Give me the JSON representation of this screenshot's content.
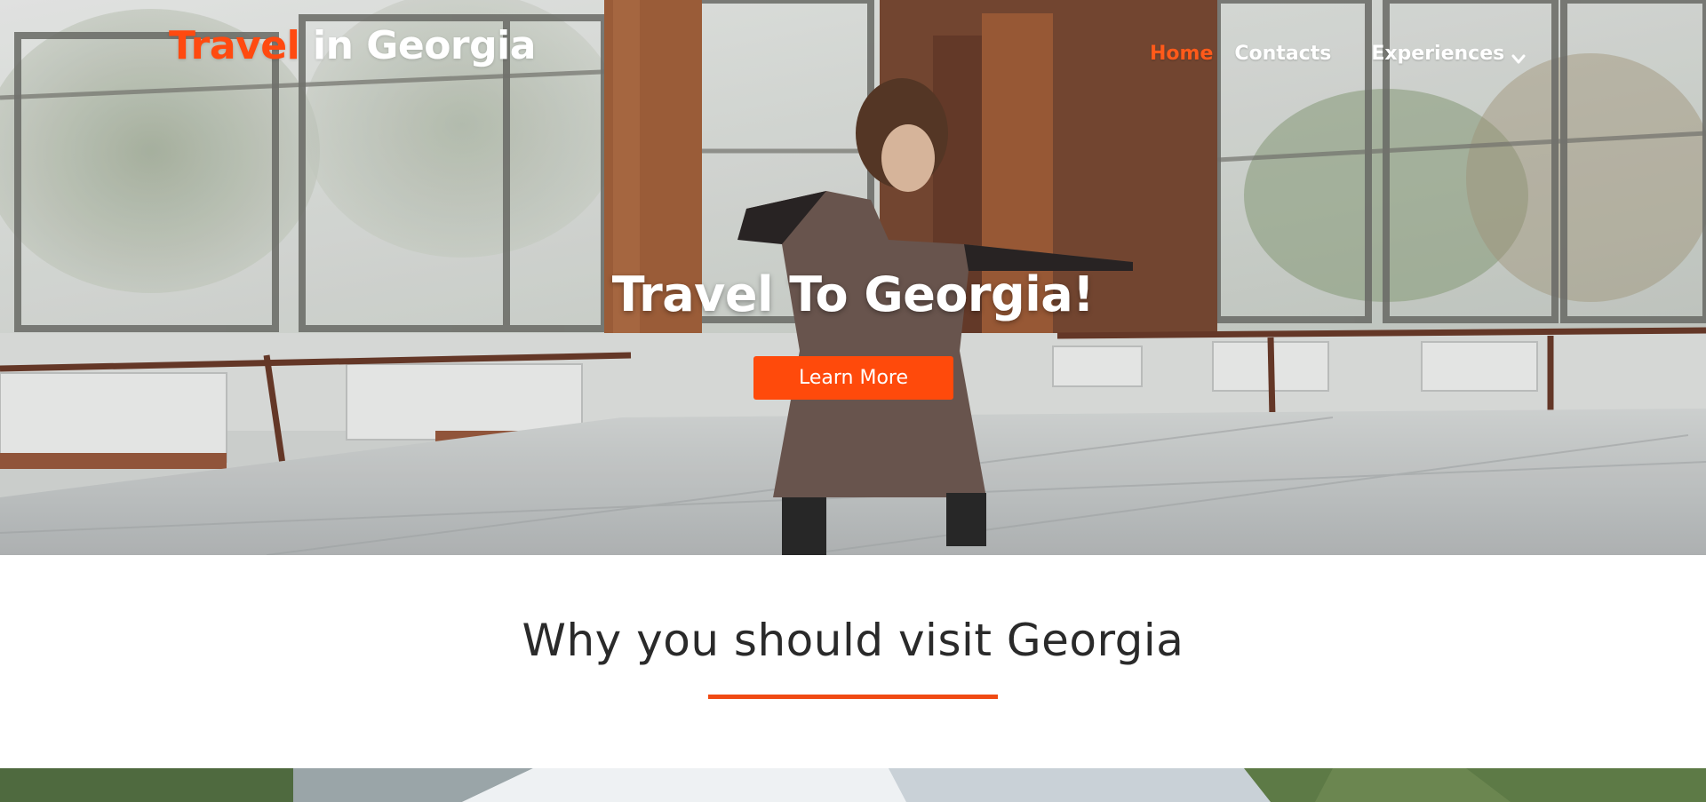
{
  "brand": {
    "accent_part": "Travel",
    "rest_part": " in Georgia"
  },
  "nav": {
    "items": [
      {
        "label": "Home",
        "active": true
      },
      {
        "label": "Contacts",
        "active": false
      },
      {
        "label": "Experiences",
        "active": false,
        "has_dropdown": true
      }
    ],
    "dropdown_icon": "chevron-down-icon"
  },
  "hero": {
    "title": "Travel To Georgia!",
    "cta_label": "Learn More",
    "image": "dancer-in-studio"
  },
  "section": {
    "title": "Why you should visit Georgia"
  },
  "bottom_image": "mountain-landscape",
  "colors": {
    "accent": "#ff4a0b",
    "text_dark": "#2a2a2a",
    "white": "#ffffff"
  }
}
